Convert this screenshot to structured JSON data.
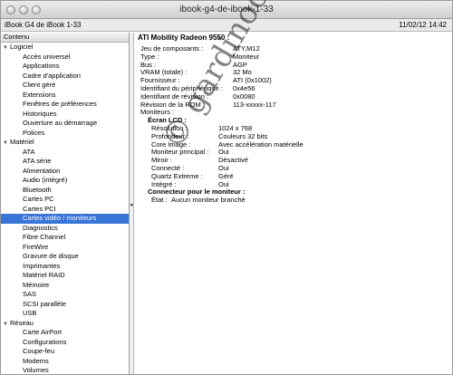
{
  "window": {
    "title": "ibook-g4-de-ibook-1-33"
  },
  "infobar": {
    "machine": "iBook G4 de iBook 1-33",
    "datetime": "11/02/12 14:42"
  },
  "sidebar": {
    "header": "Contenu",
    "groups": [
      {
        "label": "Logiciel",
        "items": [
          "Accès universel",
          "Applications",
          "Cadre d'application",
          "Client géré",
          "Extensions",
          "Fenêtres de préférences",
          "Historiques",
          "Ouverture au démarrage",
          "Polices"
        ]
      },
      {
        "label": "Matériel",
        "items": [
          "ATA",
          "ATA série",
          "Alimentation",
          "Audio (intégré)",
          "Bluetooth",
          "Cartes PC",
          "Cartes PCI",
          "Cartes vidéo / moniteurs",
          "Diagnostics",
          "Fibre Channel",
          "FireWire",
          "Gravure de disque",
          "Imprimantes",
          "Matériel RAID",
          "Mémoire",
          "SAS",
          "SCSI parallèle",
          "USB"
        ]
      },
      {
        "label": "Réseau",
        "items": [
          "Carte AirPort",
          "Configurations",
          "Coupe-feu",
          "Modems",
          "Volumes"
        ]
      }
    ],
    "selected": "Cartes vidéo / moniteurs"
  },
  "detail": {
    "title": "ATI Mobility Radeon 9550 :",
    "props": [
      {
        "k": "Jeu de composants :",
        "v": "ATY,M12"
      },
      {
        "k": "Type :",
        "v": "Moniteur"
      },
      {
        "k": "Bus :",
        "v": "AGP"
      },
      {
        "k": "VRAM (totale) :",
        "v": "32 Mo"
      },
      {
        "k": "Fournisseur :",
        "v": "ATI (0x1002)"
      },
      {
        "k": "Identifiant du périphérique :",
        "v": "0x4e56"
      },
      {
        "k": "Identifiant de révision :",
        "v": "0x0080"
      },
      {
        "k": "Révision de la ROM :",
        "v": "113-xxxxx-117"
      },
      {
        "k": "Moniteurs :",
        "v": ""
      }
    ],
    "lcd_header": "Écran LCD :",
    "lcd": [
      {
        "k": "Résolution :",
        "v": "1024 x 768"
      },
      {
        "k": "Profondeur :",
        "v": "Couleurs 32 bits"
      },
      {
        "k": "Core Image :",
        "v": "Avec accélération matérielle"
      },
      {
        "k": "Moniteur principal :",
        "v": "Oui"
      },
      {
        "k": "Miroir :",
        "v": "Désactivé"
      },
      {
        "k": "Connecté :",
        "v": "Oui"
      },
      {
        "k": "Quartz Extreme :",
        "v": "Géré"
      },
      {
        "k": "Intégré :",
        "v": "Oui"
      }
    ],
    "connector_header": "Connecteur pour le moniteur :",
    "connector": {
      "k": "État :",
      "v": "Aucun moniteur branché"
    }
  },
  "watermark": "© gardinoc.fr"
}
